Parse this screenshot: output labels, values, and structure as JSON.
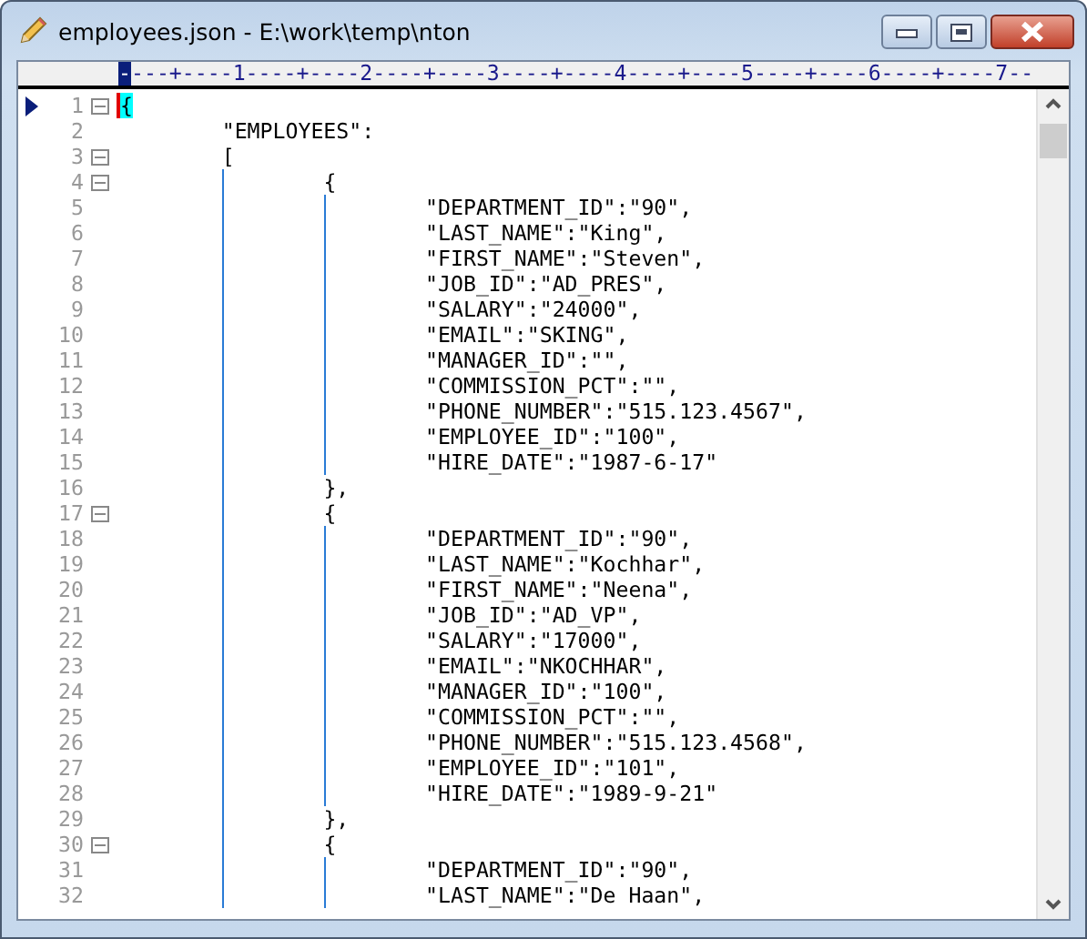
{
  "window": {
    "title": "employees.json - E:\\work\\temp\\nton"
  },
  "ruler": {
    "cursor_mark": "-",
    "text": "---+----1----+----2----+----3----+----4----+----5----+----6----+----7--"
  },
  "lines": [
    {
      "number": "1",
      "text": "{",
      "foldable": true,
      "current": true
    },
    {
      "number": "2",
      "text": "\t\"EMPLOYEES\":",
      "foldable": false,
      "current": false
    },
    {
      "number": "3",
      "text": "\t[",
      "foldable": true,
      "current": false
    },
    {
      "number": "4",
      "text": "\t\t{",
      "foldable": true,
      "current": false
    },
    {
      "number": "5",
      "text": "\t\t\t\"DEPARTMENT_ID\":\"90\",",
      "foldable": false,
      "current": false
    },
    {
      "number": "6",
      "text": "\t\t\t\"LAST_NAME\":\"King\",",
      "foldable": false,
      "current": false
    },
    {
      "number": "7",
      "text": "\t\t\t\"FIRST_NAME\":\"Steven\",",
      "foldable": false,
      "current": false
    },
    {
      "number": "8",
      "text": "\t\t\t\"JOB_ID\":\"AD_PRES\",",
      "foldable": false,
      "current": false
    },
    {
      "number": "9",
      "text": "\t\t\t\"SALARY\":\"24000\",",
      "foldable": false,
      "current": false
    },
    {
      "number": "10",
      "text": "\t\t\t\"EMAIL\":\"SKING\",",
      "foldable": false,
      "current": false
    },
    {
      "number": "11",
      "text": "\t\t\t\"MANAGER_ID\":\"\",",
      "foldable": false,
      "current": false
    },
    {
      "number": "12",
      "text": "\t\t\t\"COMMISSION_PCT\":\"\",",
      "foldable": false,
      "current": false
    },
    {
      "number": "13",
      "text": "\t\t\t\"PHONE_NUMBER\":\"515.123.4567\",",
      "foldable": false,
      "current": false
    },
    {
      "number": "14",
      "text": "\t\t\t\"EMPLOYEE_ID\":\"100\",",
      "foldable": false,
      "current": false
    },
    {
      "number": "15",
      "text": "\t\t\t\"HIRE_DATE\":\"1987-6-17\"",
      "foldable": false,
      "current": false
    },
    {
      "number": "16",
      "text": "\t\t},",
      "foldable": false,
      "current": false
    },
    {
      "number": "17",
      "text": "\t\t{",
      "foldable": true,
      "current": false
    },
    {
      "number": "18",
      "text": "\t\t\t\"DEPARTMENT_ID\":\"90\",",
      "foldable": false,
      "current": false
    },
    {
      "number": "19",
      "text": "\t\t\t\"LAST_NAME\":\"Kochhar\",",
      "foldable": false,
      "current": false
    },
    {
      "number": "20",
      "text": "\t\t\t\"FIRST_NAME\":\"Neena\",",
      "foldable": false,
      "current": false
    },
    {
      "number": "21",
      "text": "\t\t\t\"JOB_ID\":\"AD_VP\",",
      "foldable": false,
      "current": false
    },
    {
      "number": "22",
      "text": "\t\t\t\"SALARY\":\"17000\",",
      "foldable": false,
      "current": false
    },
    {
      "number": "23",
      "text": "\t\t\t\"EMAIL\":\"NKOCHHAR\",",
      "foldable": false,
      "current": false
    },
    {
      "number": "24",
      "text": "\t\t\t\"MANAGER_ID\":\"100\",",
      "foldable": false,
      "current": false
    },
    {
      "number": "25",
      "text": "\t\t\t\"COMMISSION_PCT\":\"\",",
      "foldable": false,
      "current": false
    },
    {
      "number": "26",
      "text": "\t\t\t\"PHONE_NUMBER\":\"515.123.4568\",",
      "foldable": false,
      "current": false
    },
    {
      "number": "27",
      "text": "\t\t\t\"EMPLOYEE_ID\":\"101\",",
      "foldable": false,
      "current": false
    },
    {
      "number": "28",
      "text": "\t\t\t\"HIRE_DATE\":\"1989-9-21\"",
      "foldable": false,
      "current": false
    },
    {
      "number": "29",
      "text": "\t\t},",
      "foldable": false,
      "current": false
    },
    {
      "number": "30",
      "text": "\t\t{",
      "foldable": true,
      "current": false
    },
    {
      "number": "31",
      "text": "\t\t\t\"DEPARTMENT_ID\":\"90\",",
      "foldable": false,
      "current": false
    },
    {
      "number": "32",
      "text": "\t\t\t\"LAST_NAME\":\"De Haan\",",
      "foldable": false,
      "current": false
    }
  ]
}
